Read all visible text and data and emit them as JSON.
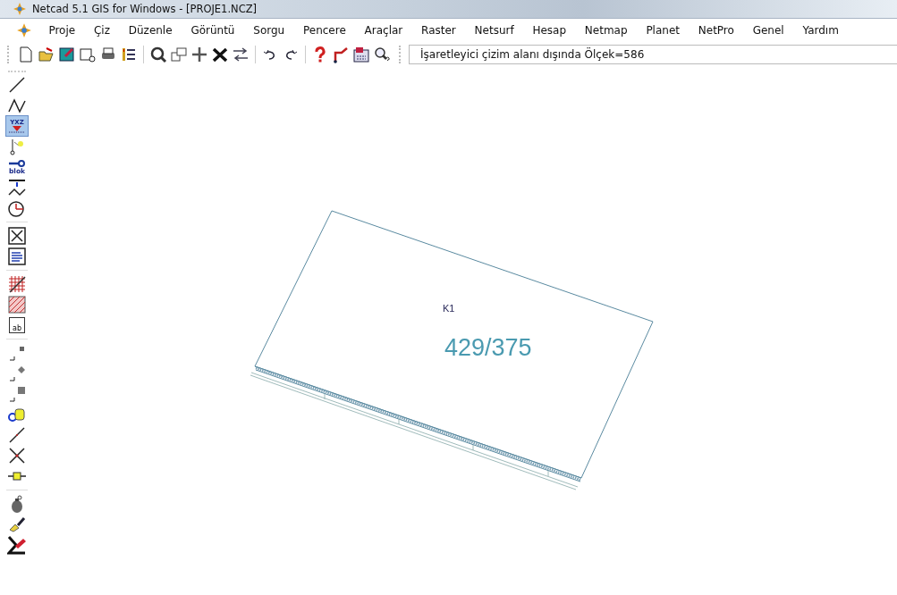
{
  "window": {
    "title": "Netcad 5.1 GIS for Windows - [PROJE1.NCZ]"
  },
  "menu": [
    {
      "label": "Proje"
    },
    {
      "label": "Çiz"
    },
    {
      "label": "Düzenle"
    },
    {
      "label": "Görüntü"
    },
    {
      "label": "Sorgu"
    },
    {
      "label": "Pencere"
    },
    {
      "label": "Araçlar"
    },
    {
      "label": "Raster"
    },
    {
      "label": "Netsurf"
    },
    {
      "label": "Hesap"
    },
    {
      "label": "Netmap"
    },
    {
      "label": "Planet"
    },
    {
      "label": "NetPro"
    },
    {
      "label": "Genel"
    },
    {
      "label": "Yardım"
    }
  ],
  "status_field": {
    "value": "İşaretleyici çizim alanı dışında Ölçek=586"
  },
  "left_tools": [
    {
      "kind": "line",
      "selected": false
    },
    {
      "kind": "polyline",
      "selected": false
    },
    {
      "kind": "coordinate",
      "text": "YXZ",
      "selected": true
    },
    {
      "kind": "point",
      "selected": false
    },
    {
      "kind": "block",
      "text": "blok",
      "selected": false
    },
    {
      "kind": "break",
      "selected": false
    },
    {
      "kind": "clock",
      "selected": false
    },
    {
      "kind": "cross-box",
      "selected": false
    },
    {
      "kind": "text-box",
      "selected": false
    },
    {
      "kind": "grid",
      "selected": false
    },
    {
      "kind": "hatch",
      "selected": false
    },
    {
      "kind": "label",
      "text": "ab",
      "selected": false
    },
    {
      "kind": "corner-small",
      "selected": false
    },
    {
      "kind": "corner-diamond",
      "selected": false
    },
    {
      "kind": "corner-square",
      "selected": false
    },
    {
      "kind": "chain",
      "selected": false
    },
    {
      "kind": "slash",
      "selected": false
    },
    {
      "kind": "x-cross",
      "selected": false
    },
    {
      "kind": "node",
      "selected": false
    },
    {
      "kind": "grenade",
      "selected": false
    },
    {
      "kind": "brush",
      "selected": false
    },
    {
      "kind": "eraser",
      "selected": false
    }
  ],
  "canvas": {
    "parcel": {
      "name": "K1",
      "number": "429/375"
    }
  }
}
